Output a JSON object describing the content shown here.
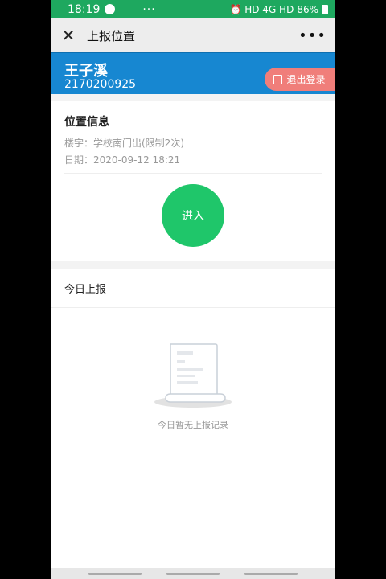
{
  "status_bar": {
    "time": "18:19",
    "dots": "···",
    "indicators": "⏰ HD 4G HD",
    "battery": "86%"
  },
  "navbar": {
    "close_icon": "close-icon",
    "title": "上报位置",
    "more": "•••"
  },
  "profile": {
    "name": "王子溪",
    "student_id": "2170200925",
    "logout_label": "退出登录",
    "bg_color": "#1787d1",
    "logout_color": "#f07e7a"
  },
  "location": {
    "title": "位置信息",
    "building": "楼宇：学校南门出(限制2次)",
    "date": "日期：2020-09-12 18:21",
    "enter_label": "进入",
    "enter_color": "#1fc66a"
  },
  "today": {
    "title": "今日上报",
    "empty_text": "今日暂无上报记录",
    "empty_icon": "empty-document-icon"
  }
}
